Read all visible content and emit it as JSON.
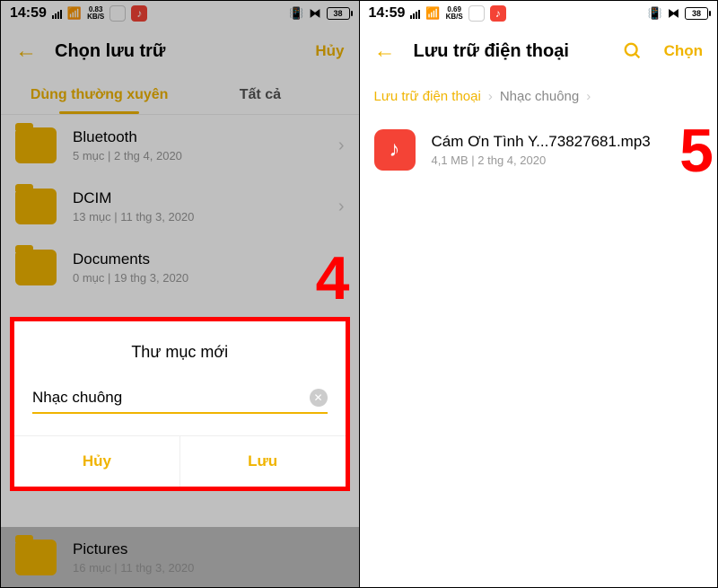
{
  "status": {
    "time": "14:59",
    "net_speed": "0.83",
    "net_unit": "KB/S",
    "net_speed2": "0.69",
    "battery": "38"
  },
  "left": {
    "title": "Chọn lưu trữ",
    "cancel": "Hủy",
    "tab1": "Dùng thường xuyên",
    "tab2": "Tất cả",
    "items": [
      {
        "name": "Bluetooth",
        "meta": "5 mục | 2 thg 4, 2020"
      },
      {
        "name": "DCIM",
        "meta": "13 mục | 11 thg 3, 2020"
      },
      {
        "name": "Documents",
        "meta": "0 mục | 19 thg 3, 2020"
      },
      {
        "name": "Pictures",
        "meta": "16 mục | 11 thg 3, 2020"
      }
    ],
    "dialog": {
      "title": "Thư mục mới",
      "value": "Nhạc chuông",
      "cancel": "Hủy",
      "save": "Lưu"
    },
    "step": "4"
  },
  "right": {
    "title": "Lưu trữ điện thoại",
    "choose": "Chọn",
    "crumb1": "Lưu trữ điện thoại",
    "crumb2": "Nhạc chuông",
    "file": {
      "name": "Cám Ơn Tình Y...73827681.mp3",
      "meta": "4,1 MB | 2 thg 4, 2020"
    },
    "step": "5"
  }
}
